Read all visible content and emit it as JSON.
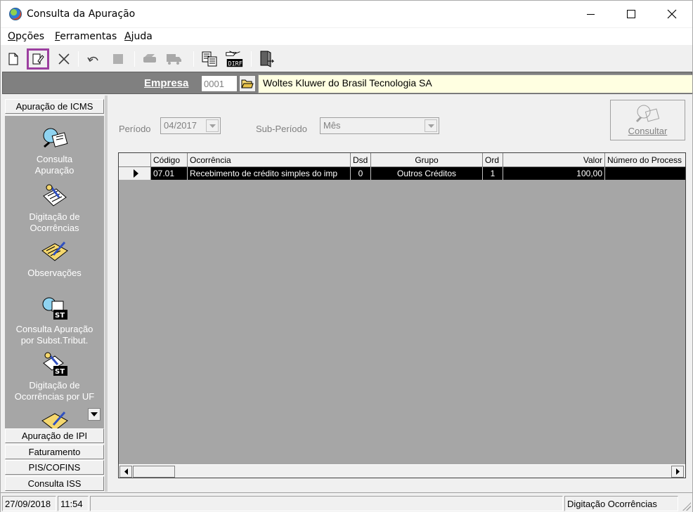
{
  "window": {
    "title": "Consulta da Apuração"
  },
  "menu": [
    {
      "label": "Opções",
      "accel": "O",
      "rest": "pções"
    },
    {
      "label": "Ferramentas",
      "accel": "F",
      "rest": "erramentas"
    },
    {
      "label": "Ajuda",
      "accel": "A",
      "rest": "juda"
    }
  ],
  "toolbar": {
    "icons": [
      "new-document-icon",
      "edit-document-icon",
      "delete-x-icon",
      "undo-icon",
      "stop-icon",
      "print-icon",
      "truck-icon",
      "export-icon",
      "dirf-icon",
      "exit-door-icon"
    ]
  },
  "empresa": {
    "label": "Empresa",
    "code": "0001",
    "name": "Woltes Kluwer do Brasil Tecnologia SA"
  },
  "side": {
    "header": "Apuração de ICMS",
    "tools": [
      {
        "label1": "Consulta",
        "label2": "Apuração"
      },
      {
        "label1": "Digitação de",
        "label2": "Ocorrências"
      },
      {
        "label1": "Observações",
        "label2": ""
      },
      {
        "label1": "Consulta  Apuração",
        "label2": "por Subst.Tribut."
      },
      {
        "label1": "Digitação de",
        "label2": "Ocorrências por UF"
      }
    ],
    "tabs": [
      "Apuração de IPI",
      "Faturamento",
      "PIS/COFINS",
      "Consulta ISS"
    ]
  },
  "filters": {
    "periodo_label": "Período",
    "periodo_value": "04/2017",
    "subperiodo_label": "Sub-Período",
    "subperiodo_value": "Mês",
    "consultar_label": "Consultar"
  },
  "grid": {
    "columns": [
      "Código",
      "Ocorrência",
      "Dsd",
      "Grupo",
      "Ord",
      "Valor",
      "Número do Process"
    ],
    "rows": [
      {
        "codigo": "07.01",
        "ocorrencia": "Recebimento de crédito simples do imp",
        "dsd": "0",
        "grupo": "Outros Créditos",
        "ord": "1",
        "valor": "100,00",
        "numero": ""
      }
    ]
  },
  "status": {
    "date": "27/09/2018",
    "time": "11:54",
    "message": "",
    "mode": "Digitação Ocorrências"
  }
}
